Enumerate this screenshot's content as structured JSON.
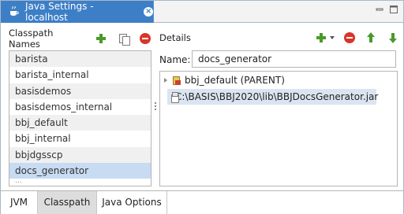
{
  "window": {
    "tab_title": "Java Settings - localhost",
    "close_glyph": "×"
  },
  "left_panel": {
    "header": "Classpath Names",
    "items": [
      "barista",
      "barista_internal",
      "basisdemos",
      "basisdemos_internal",
      "bbj_default",
      "bbj_internal",
      "bbjdgsscp",
      "docs_generator"
    ],
    "selected": "docs_generator",
    "truncated_item": "..."
  },
  "right_panel": {
    "header": "Details",
    "name_label": "Name:",
    "name_value": "docs_generator",
    "tree": [
      {
        "label": "bbj_default (PARENT)",
        "icon": "library-icon",
        "expandable": true
      },
      {
        "label": "C:\\BASIS\\BBJ2020\\lib\\BBJDocsGenerator.jar",
        "icon": "jar-icon",
        "selected": true
      }
    ]
  },
  "bottom_tabs": [
    "JVM",
    "Classpath",
    "Java Options"
  ],
  "active_bottom_tab": "Classpath",
  "colors": {
    "tab_active": "#3d7fc6",
    "selection": "#c7dbf2",
    "add_green": "#4a9a2a",
    "remove_red": "#d9352a"
  }
}
